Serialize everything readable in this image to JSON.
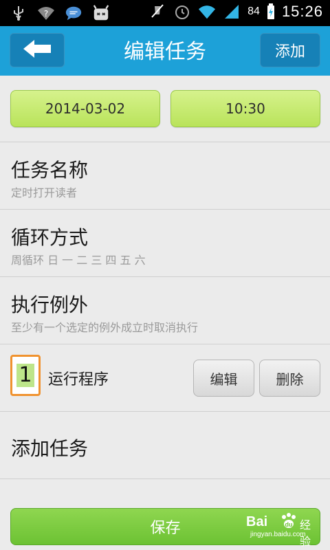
{
  "status_bar": {
    "battery": "84",
    "time": "15:26",
    "icons": [
      "usb-icon",
      "wifi-question-icon",
      "chat-bubble-icon",
      "android-robot-icon",
      "mute-icon",
      "alarm-icon",
      "wifi-icon",
      "signal-icon",
      "battery-charging-icon"
    ]
  },
  "header": {
    "title": "编辑任务",
    "back_icon": "arrow-left-icon",
    "add_label": "添加"
  },
  "schedule": {
    "date": "2014-03-02",
    "time": "10:30"
  },
  "task_name": {
    "title": "任务名称",
    "value": "定时打开读者"
  },
  "repeat": {
    "title": "循环方式",
    "value": "周循环 日 一 二 三 四 五 六"
  },
  "exceptions": {
    "title": "执行例外",
    "value": "至少有一个选定的例外成立时取消执行"
  },
  "program": {
    "index": "1",
    "label": "运行程序",
    "edit_label": "编辑",
    "delete_label": "删除"
  },
  "add_task": {
    "title": "添加任务"
  },
  "footer": {
    "save_label": "保存"
  },
  "watermark": {
    "logo_text": "Bai",
    "logo_cn": "经验",
    "url": "jingyan.baidu.com"
  },
  "colors": {
    "title_bar": "#1da1d8",
    "title_button": "#1681b7",
    "green_button": "#b9e35a",
    "save_button": "#6cc233",
    "highlight_border": "#f0922e"
  }
}
